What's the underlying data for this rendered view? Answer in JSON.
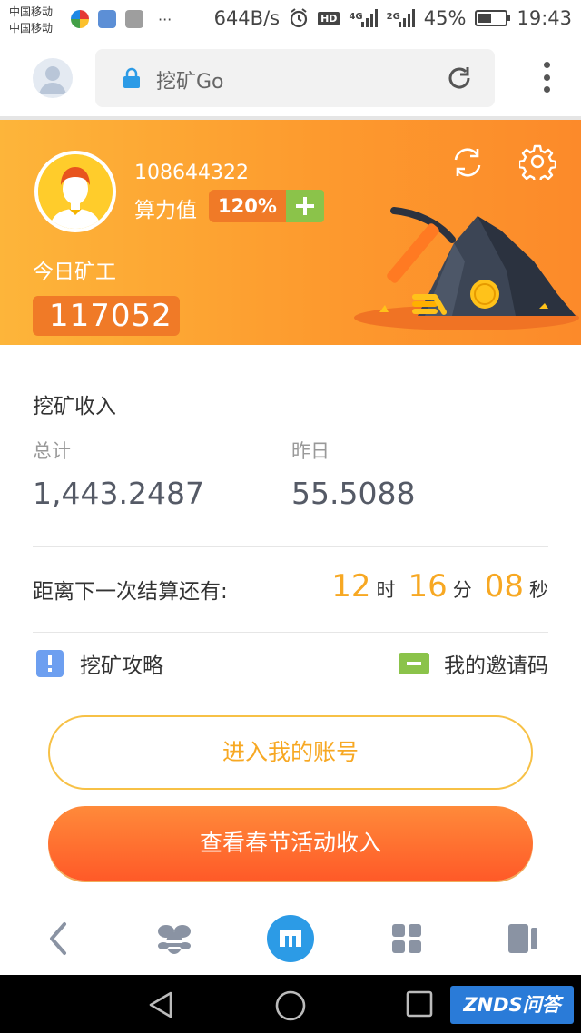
{
  "status_bar": {
    "carrier_1": "中国移动",
    "carrier_2": "中国移动",
    "more": "···",
    "net_speed": "644B/s",
    "hd_badge": "HD",
    "sim1_label": "4G",
    "sim2_label": "2G",
    "battery": "45%",
    "time": "19:43",
    "icons": [
      "app-icon",
      "health-icon",
      "gallery-icon",
      "alarm-icon",
      "signal-icon",
      "battery-icon"
    ]
  },
  "address_bar": {
    "url_text": "挖矿Go",
    "icons": [
      "user-avatar-icon",
      "lock-icon",
      "reload-icon",
      "more-vertical-icon"
    ]
  },
  "profile": {
    "user_id": "108644322",
    "power_label": "算力值",
    "power_value": "120%",
    "today_label": "今日矿工",
    "today_count": "117052",
    "icons": [
      "avatar-icon",
      "plus-icon",
      "sync-icon",
      "gear-icon",
      "mining-illustration"
    ]
  },
  "income": {
    "title": "挖矿收入",
    "total_label": "总计",
    "total_value": "1,443.2487",
    "yesterday_label": "昨日",
    "yesterday_value": "55.5088"
  },
  "countdown": {
    "label": "距离下一次结算还有:",
    "hours": "12",
    "hours_unit": "时",
    "minutes": "16",
    "minutes_unit": "分",
    "seconds": "08",
    "seconds_unit": "秒"
  },
  "links": {
    "guide": "挖矿攻略",
    "invite": "我的邀请码"
  },
  "buttons": {
    "enter_account": "进入我的账号",
    "festival_income": "查看春节活动收入"
  },
  "bottom_nav": {
    "icons": [
      "back-icon",
      "bee-icon",
      "maxthon-home-icon",
      "grid-icon",
      "tabs-icon"
    ]
  },
  "system_nav": {
    "icons": [
      "triangle-back-icon",
      "circle-home-icon",
      "square-recents-icon"
    ],
    "watermark": "ZNDS问答"
  },
  "colors": {
    "header_start": "#fdb53a",
    "header_end": "#fc8a2a",
    "accent_orange": "#f7a823",
    "button_red": "#ff5a28",
    "plus_green": "#8bc34a",
    "nav_blue": "#2c9be6"
  }
}
